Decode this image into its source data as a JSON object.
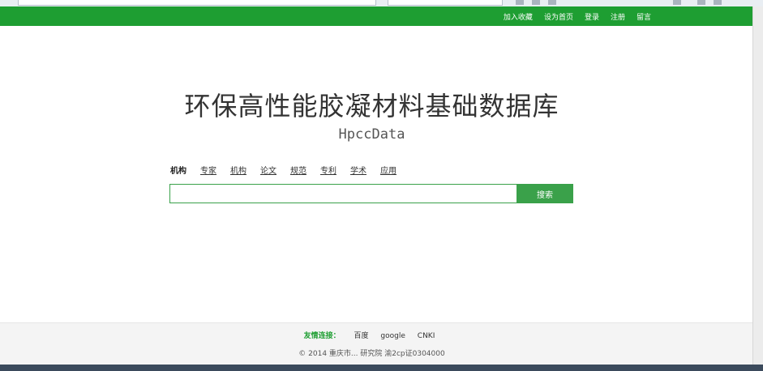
{
  "topbar": {
    "links": [
      "加入收藏",
      "设为首页",
      "登录",
      "注册",
      "留言"
    ]
  },
  "header": {
    "title": "环保高性能胶凝材料基础数据库",
    "subtitle": "HpccData"
  },
  "search": {
    "tabs": [
      "机构",
      "专家",
      "机构",
      "论文",
      "规范",
      "专利",
      "学术",
      "应用"
    ],
    "active_tab_index": 0,
    "input_value": "",
    "input_placeholder": "",
    "button_label": "搜索"
  },
  "footer": {
    "friends_label": "友情连接：",
    "friends_links": [
      "百度",
      "google",
      "CNKI"
    ],
    "copyright": "© 2014 重庆市... 研究院 渝2cp证0304000"
  },
  "colors": {
    "brand_green": "#1e9e32",
    "button_green": "#3aa14a"
  }
}
